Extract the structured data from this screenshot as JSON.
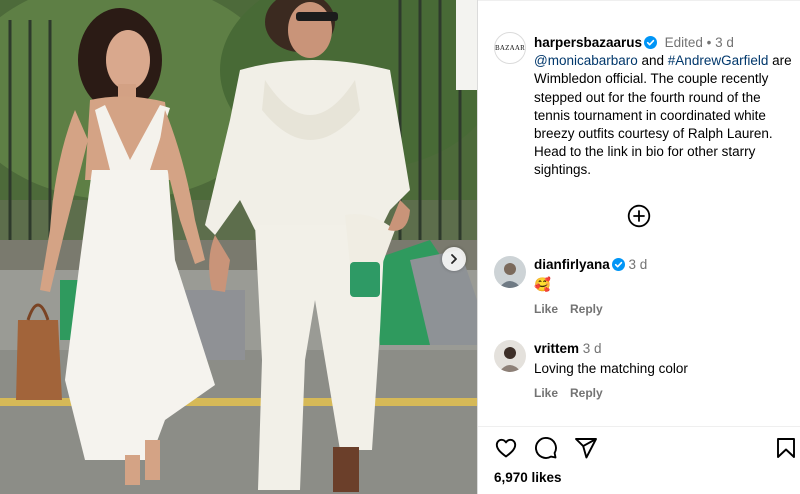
{
  "post": {
    "photo_alt": "Monica Barbaro and Andrew Garfield at Wimbledon",
    "likes_text": "6,970 likes"
  },
  "caption": {
    "avatar_text": "BAZAAR",
    "username": "harpersbazaarus",
    "edited": "Edited",
    "dot": "•",
    "time": "3 d",
    "mention": "@monicabarbaro",
    "and_text": " and ",
    "hashtag": "#AndrewGarfield",
    "body": " are Wimbledon official. The couple recently stepped out for the fourth round of the tennis tournament in coordinated white breezy outfits courtesy of Ralph Lauren. Head to the link in bio for other starry sightings."
  },
  "comments": [
    {
      "username": "dianfirlyana",
      "time": "3 d",
      "text": "🥰",
      "like": "Like",
      "reply": "Reply"
    },
    {
      "username": "vrittem",
      "time": "3 d",
      "text": "Loving the matching color",
      "like": "Like",
      "reply": "Reply"
    }
  ],
  "colors": {
    "verified": "#0095f6",
    "link": "#00376b",
    "meta": "#737373"
  },
  "icons": [
    "heart-icon",
    "comment-icon",
    "share-icon",
    "bookmark-icon",
    "add-circle-icon",
    "chevron-right-icon",
    "verified-badge-icon"
  ]
}
